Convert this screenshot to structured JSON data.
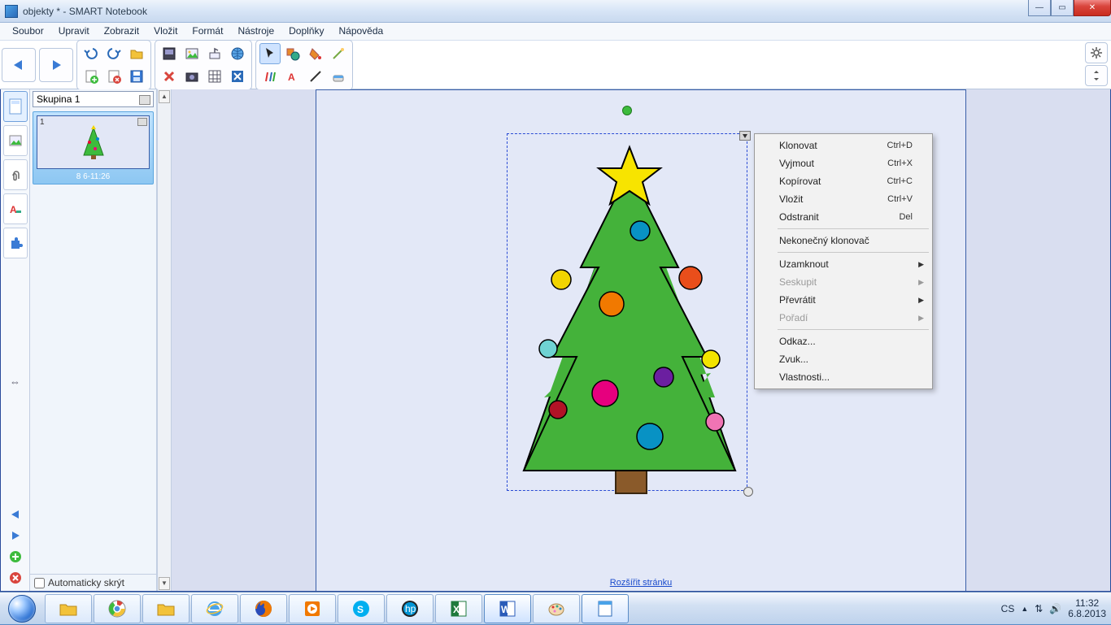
{
  "title": "objekty * - SMART Notebook",
  "menu": [
    "Soubor",
    "Upravit",
    "Zobrazit",
    "Vložit",
    "Formát",
    "Nástroje",
    "Doplňky",
    "Nápověda"
  ],
  "group_selector": "Skupina 1",
  "thumb": {
    "num": "1",
    "label": "8 6-11:26"
  },
  "auto_hide": "Automaticky skrýt",
  "extend_page": "Rozšířit stránku",
  "context": [
    {
      "label": "Klonovat",
      "shortcut": "Ctrl+D"
    },
    {
      "label": "Vyjmout",
      "shortcut": "Ctrl+X"
    },
    {
      "label": "Kopírovat",
      "shortcut": "Ctrl+C"
    },
    {
      "label": "Vložit",
      "shortcut": "Ctrl+V"
    },
    {
      "label": "Odstranit",
      "shortcut": "Del"
    },
    {
      "sep": true
    },
    {
      "label": "Nekonečný klonovač"
    },
    {
      "sep": true
    },
    {
      "label": "Uzamknout",
      "sub": true
    },
    {
      "label": "Seskupit",
      "sub": true,
      "disabled": true
    },
    {
      "label": "Převrátit",
      "sub": true
    },
    {
      "label": "Pořadí",
      "sub": true,
      "disabled": true
    },
    {
      "sep": true
    },
    {
      "label": "Odkaz..."
    },
    {
      "label": "Zvuk..."
    },
    {
      "label": "Vlastnosti..."
    }
  ],
  "tray": {
    "lang": "CS",
    "time": "11:32",
    "date": "6.8.2013"
  }
}
